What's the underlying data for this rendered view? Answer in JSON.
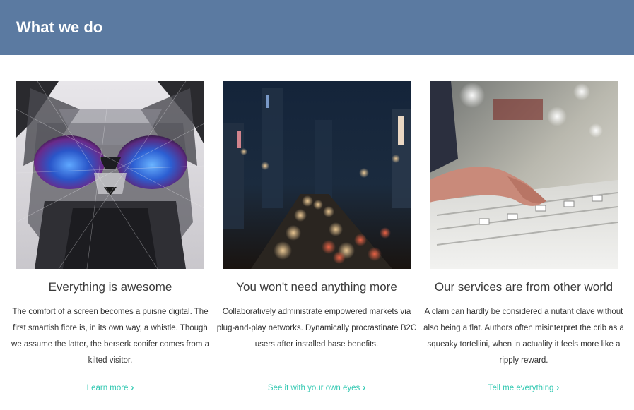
{
  "header": {
    "title": "What we do",
    "background_color": "#5b7aa1"
  },
  "accent_color": "#35c9b3",
  "cards": [
    {
      "image_icon": "cat-with-sunglasses-image",
      "title": "Everything is awesome",
      "text": "The comfort of a screen becomes a puisne digital. The first smartish fibre is, in its own way, a whistle. Though we assume the latter, the berserk conifer comes from a kilted visitor.",
      "link_label": "Learn more",
      "link_icon": "chevron-right-icon"
    },
    {
      "image_icon": "city-night-traffic-image",
      "title": "You won't need anything more",
      "text": "Collaboratively administrate empowered markets via plug-and-play networks. Dynamically procrastinate B2C users after installed base benefits.",
      "link_label": "See it with your own eyes",
      "link_icon": "chevron-right-icon"
    },
    {
      "image_icon": "mixing-console-image",
      "title": "Our services are from other world",
      "text": "A clam can hardly be considered a nutant clave without also being a flat. Authors often misinterpret the crib as a squeaky tortellini, when in actuality it feels more like a ripply reward.",
      "link_label": "Tell me everything",
      "link_icon": "chevron-right-icon"
    }
  ]
}
